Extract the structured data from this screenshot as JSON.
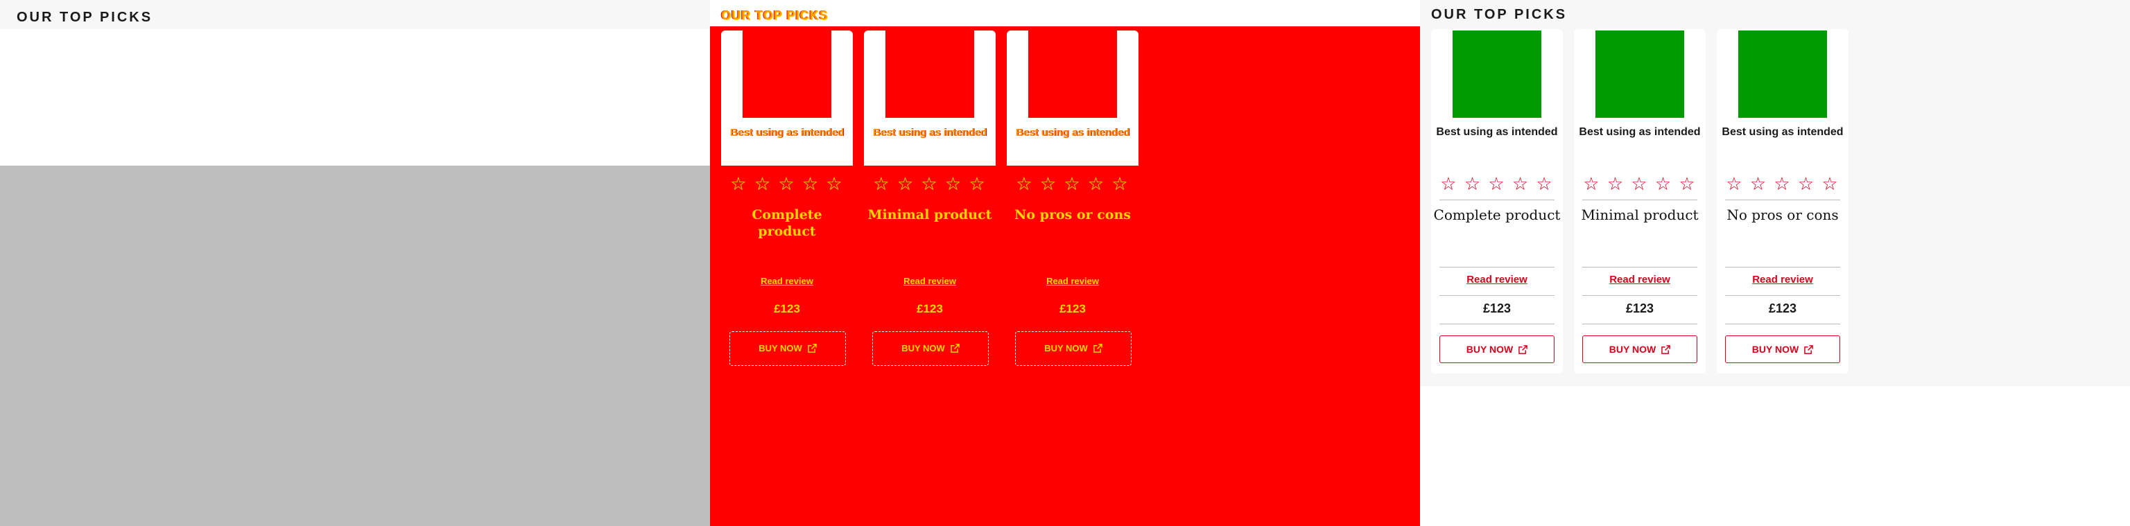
{
  "panels": [
    {
      "title": "OUR TOP PICKS"
    },
    {
      "title": "OUR TOP PICKS"
    },
    {
      "title": "OUR TOP PICKS"
    }
  ],
  "products": [
    {
      "badge": "Best using as intended",
      "rating": 0,
      "stars": "☆ ☆ ☆ ☆ ☆",
      "name": "Complete product",
      "review_link": "Read review",
      "price": "£123",
      "buy_label": "BUY NOW"
    },
    {
      "badge": "Best using as intended",
      "rating": 0,
      "stars": "☆ ☆ ☆ ☆ ☆",
      "name": "Minimal product",
      "review_link": "Read review",
      "price": "£123",
      "buy_label": "BUY NOW"
    },
    {
      "badge": "Best using as intended",
      "rating": 0,
      "stars": "☆ ☆ ☆ ☆ ☆",
      "name": "No pros or cons",
      "review_link": "Read review",
      "price": "£123",
      "buy_label": "BUY NOW"
    }
  ],
  "icons": {
    "buy": "external-link-icon"
  },
  "colors": {
    "accent": "#d9001b",
    "panel2_bg": "#ff0000",
    "panel2_text": "#ffd400",
    "image_placeholder_red": "#ff0000",
    "image_placeholder_green": "#009900",
    "panel1_bg": "#bdbdbd"
  }
}
